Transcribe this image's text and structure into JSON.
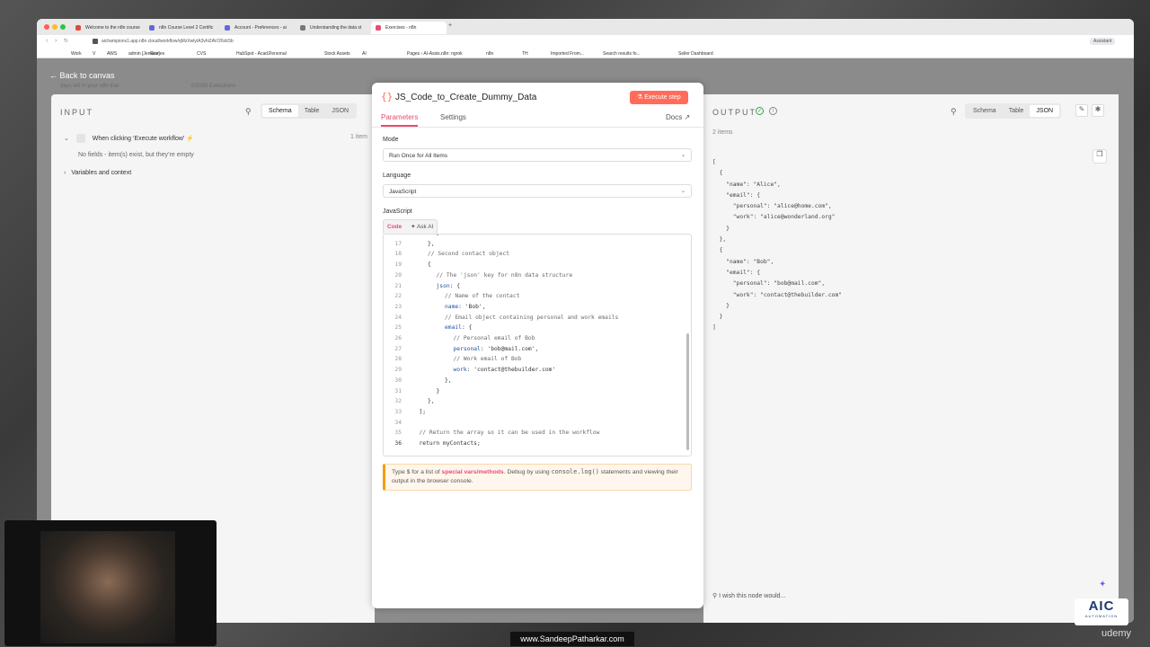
{
  "browser": {
    "tabs": [
      {
        "label": "Welcome to the n8n course",
        "color": "#e04a3a"
      },
      {
        "label": "n8n Course Level 2 Certific",
        "color": "#5f6ad8"
      },
      {
        "label": "Account - Preferences - ai",
        "color": "#5f6ad8"
      },
      {
        "label": "Understanding the data st",
        "color": "#777777"
      },
      {
        "label": "Exercises - n8n",
        "color": "#ea4b71"
      }
    ],
    "new_tab": "+",
    "url": "aichampions1.app.n8n.cloud/workflow/qMzXwlyIA3vhi2AV/26dc5b",
    "assistant": "Assistant",
    "bookmarks": [
      "Work",
      "V",
      "AWS",
      "admin [Jenkins]",
      "Games",
      "CVS",
      "HubSpot - Acad...",
      "Personal",
      "Stock Assets",
      "AI",
      "Pages ‹ AI-Assis...",
      "n8n: ngrok",
      "n8n",
      "TH",
      "Imported From...",
      "Search results fo...",
      "Seller Dashboard"
    ]
  },
  "app": {
    "back_label": "Back to canvas",
    "trial_text": "days left in your n8n trial",
    "executions_text": "0/1000 Executions",
    "colors": {
      "accent": "#ea4b71",
      "execute": "#ff6d5a",
      "success": "#2ea44f",
      "hint_bg": "#fff7ed",
      "hint_border": "#f59e0b"
    }
  },
  "input": {
    "title": "INPUT",
    "views": [
      "Schema",
      "Table",
      "JSON"
    ],
    "active_view": "Schema",
    "trigger_label": "When clicking ‘Execute workflow’",
    "item_count": "1 item",
    "empty_text": "No fields - item(s) exist, but they’re empty",
    "variables_label": "Variables and context"
  },
  "node": {
    "title": "JS_Code_to_Create_Dummy_Data",
    "execute_label": "Execute step",
    "tabs": [
      "Parameters",
      "Settings"
    ],
    "docs_label": "Docs",
    "mode_label": "Mode",
    "mode_value": "Run Once for All Items",
    "language_label": "Language",
    "language_value": "JavaScript",
    "code_label": "JavaScript",
    "editor_tabs": [
      "Code",
      "Ask AI"
    ],
    "code_lines": [
      {
        "n": "16",
        "indent": 3,
        "text": "}"
      },
      {
        "n": "17",
        "indent": 2,
        "text": "},"
      },
      {
        "n": "18",
        "indent": 2,
        "text": "// Second contact object"
      },
      {
        "n": "19",
        "indent": 2,
        "text": "{"
      },
      {
        "n": "20",
        "indent": 3,
        "text": "// The 'json' key for n8n data structure"
      },
      {
        "n": "21",
        "indent": 3,
        "text": "json: {"
      },
      {
        "n": "22",
        "indent": 4,
        "text": "// Name of the contact"
      },
      {
        "n": "23",
        "indent": 4,
        "text": "name: 'Bob',"
      },
      {
        "n": "24",
        "indent": 4,
        "text": "// Email object containing personal and work emails"
      },
      {
        "n": "25",
        "indent": 4,
        "text": "email: {"
      },
      {
        "n": "26",
        "indent": 5,
        "text": "// Personal email of Bob"
      },
      {
        "n": "27",
        "indent": 5,
        "text": "personal: 'bob@mail.com',"
      },
      {
        "n": "28",
        "indent": 5,
        "text": "// Work email of Bob"
      },
      {
        "n": "29",
        "indent": 5,
        "text": "work: 'contact@thebuilder.com'"
      },
      {
        "n": "30",
        "indent": 4,
        "text": "},"
      },
      {
        "n": "31",
        "indent": 3,
        "text": "}"
      },
      {
        "n": "32",
        "indent": 2,
        "text": "},"
      },
      {
        "n": "33",
        "indent": 1,
        "text": "];"
      },
      {
        "n": "34",
        "indent": 0,
        "text": ""
      },
      {
        "n": "35",
        "indent": 1,
        "text": "// Return the array so it can be used in the workflow"
      },
      {
        "n": "36",
        "indent": 1,
        "text": "return myContacts;"
      }
    ],
    "hint_prefix": "Type $ for a list of ",
    "hint_link": "special vars/methods",
    "hint_mid": ". Debug by using ",
    "hint_code": "console.log()",
    "hint_suffix": " statements and viewing their output in the browser console."
  },
  "output": {
    "title": "OUTPUT",
    "views": [
      "Schema",
      "Table",
      "JSON"
    ],
    "active_view": "JSON",
    "item_count": "2 items",
    "json_lines": [
      "[",
      "  {",
      "    \"name\": \"Alice\",",
      "    \"email\": {",
      "      \"personal\": \"alice@home.com\",",
      "      \"work\": \"alice@wonderland.org\"",
      "    }",
      "  },",
      "  {",
      "    \"name\": \"Bob\",",
      "    \"email\": {",
      "      \"personal\": \"bob@mail.com\",",
      "      \"work\": \"contact@thebuilder.com\"",
      "    }",
      "  }",
      "]"
    ],
    "feedback": "I wish this node would..."
  },
  "overlay": {
    "watermark": "www.SandeepPatharkar.com",
    "logo_main": "AIC",
    "logo_sub": "AUTOMATION",
    "udemy": "udemy"
  }
}
